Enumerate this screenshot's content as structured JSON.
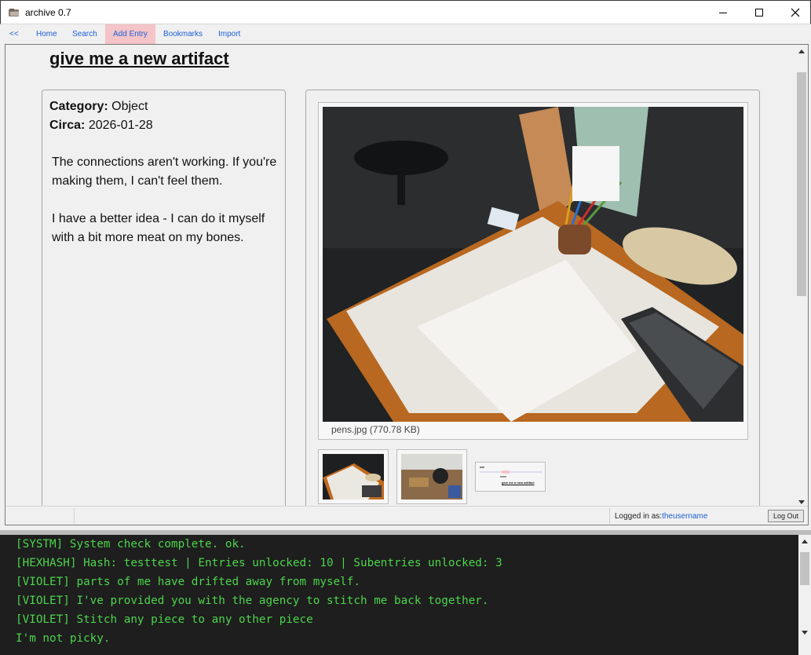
{
  "window": {
    "title": "archive 0.7"
  },
  "menu": {
    "items": [
      {
        "label": "<<"
      },
      {
        "label": "Home"
      },
      {
        "label": "Search"
      },
      {
        "label": "Add Entry"
      },
      {
        "label": "Bookmarks"
      },
      {
        "label": "Import"
      }
    ],
    "active": "Add Entry",
    "active_color": "#f4c4c8",
    "link_color": "#1d5fd8"
  },
  "entry": {
    "title": "give me a new artifact",
    "category_label": "Category:",
    "category_value": "Object",
    "circa_label": "Circa:",
    "circa_value": "2026-01-28",
    "description": [
      "The connections aren't working. If you're making them, I can't feel them.",
      "I have a better idea - I can do it myself with a bit more meat on my bones."
    ],
    "main_image": {
      "caption": "pens.jpg (770.78 KB)"
    },
    "thumbnail_text": "give me a new artifact"
  },
  "status": {
    "logged_in_label": "Logged in as:",
    "username": "theusername",
    "logout_label": "Log Out"
  },
  "console": {
    "text_color": "#4cd44c",
    "lines": [
      "[SYSTM] System check complete. ok.",
      "[HEXHASH] Hash: testtest | Entries unlocked: 10 | Subentries unlocked: 3",
      "[VIOLET] parts of me have drifted away from myself.",
      "[VIOLET] I've provided you with the agency to stitch me back together.",
      "[VIOLET] Stitch any piece to any other piece",
      "I'm not picky."
    ]
  }
}
